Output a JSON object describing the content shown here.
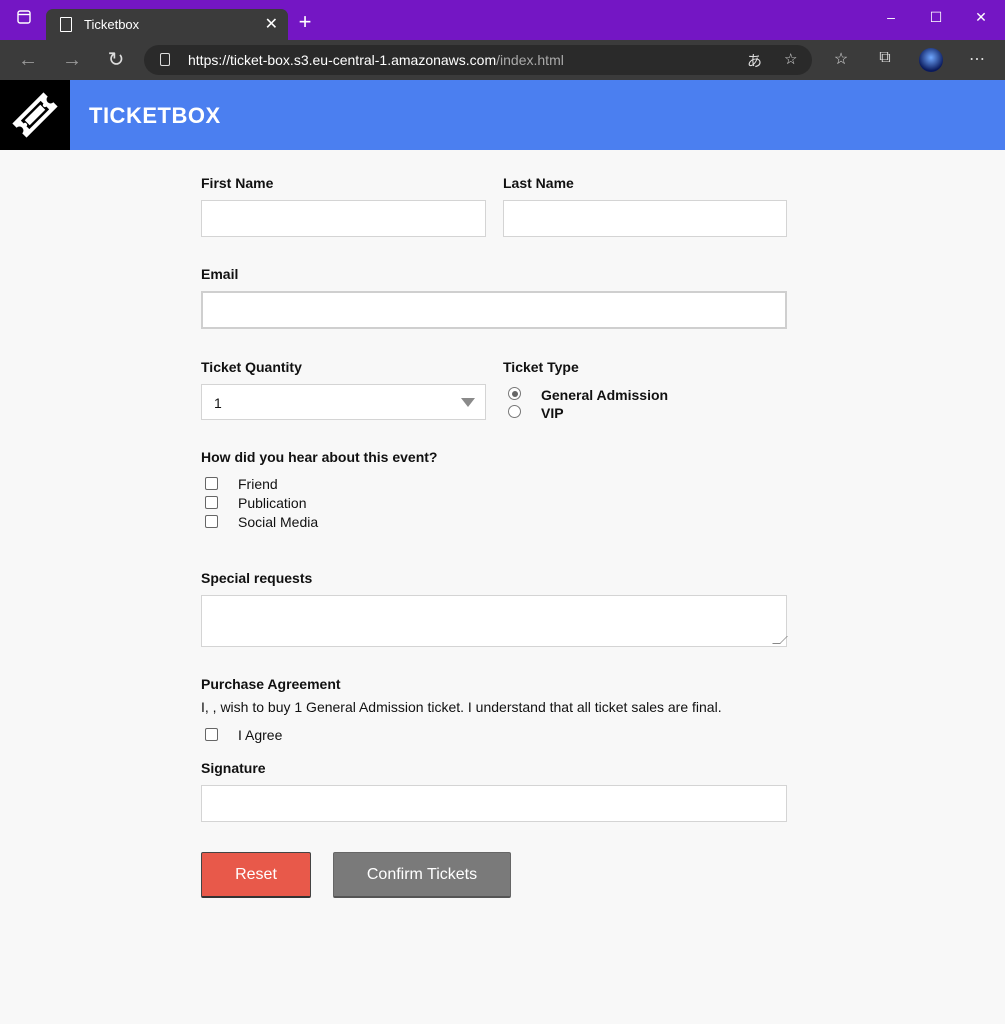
{
  "browser": {
    "tab_title": "Ticketbox",
    "url_host": "https://ticket-box.s3.eu-central-1.amazonaws.com",
    "url_path": "/index.html"
  },
  "header": {
    "brand": "TICKETBOX",
    "bg_color": "#4b7ff0"
  },
  "form": {
    "first_name_label": "First Name",
    "last_name_label": "Last Name",
    "email_label": "Email",
    "ticket_quantity_label": "Ticket Quantity",
    "ticket_quantity_value": "1",
    "ticket_type_label": "Ticket Type",
    "ticket_types": [
      {
        "label": "General Admission",
        "selected": true
      },
      {
        "label": "VIP",
        "selected": false
      }
    ],
    "hear_label": "How did you hear about this event?",
    "hear_options": [
      {
        "label": "Friend",
        "checked": false
      },
      {
        "label": "Publication",
        "checked": false
      },
      {
        "label": "Social Media",
        "checked": false
      }
    ],
    "special_requests_label": "Special requests",
    "agreement_label": "Purchase Agreement",
    "agreement_text": "I, , wish to buy 1 General Admission ticket. I understand that all ticket sales are final.",
    "agree_label": "I Agree",
    "signature_label": "Signature",
    "reset_label": "Reset",
    "confirm_label": "Confirm Tickets"
  },
  "colors": {
    "titlebar": "#7416c4",
    "reset_button": "#e8594a",
    "confirm_button": "#7a7a7a"
  }
}
